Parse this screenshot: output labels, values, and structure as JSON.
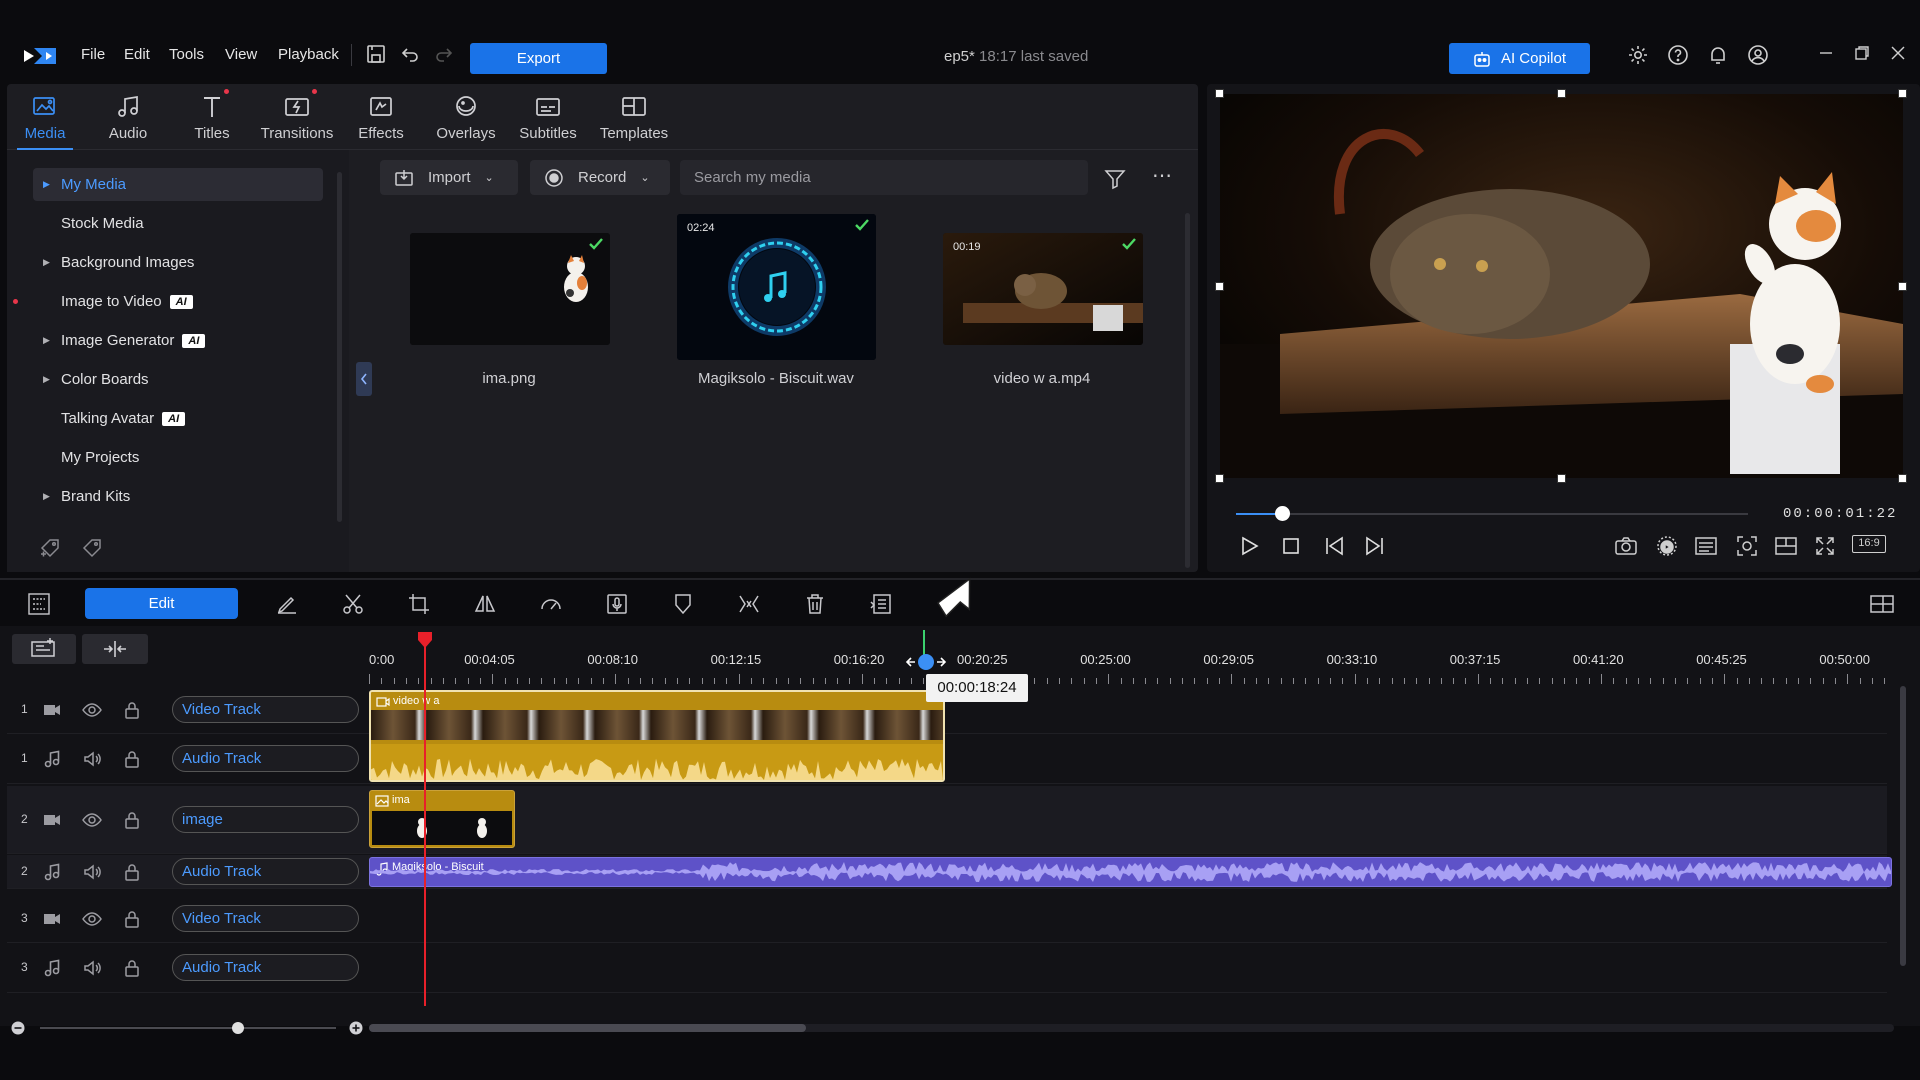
{
  "app": {
    "menu": [
      "File",
      "Edit",
      "Tools",
      "View",
      "Playback"
    ],
    "export_label": "Export",
    "project_name": "ep5*",
    "saved_status": "18:17 last saved",
    "copilot_label": "AI Copilot"
  },
  "tabs": [
    {
      "label": "Media",
      "icon": "media-icon",
      "active": true
    },
    {
      "label": "Audio",
      "icon": "music-note-icon"
    },
    {
      "label": "Titles",
      "icon": "titles-icon",
      "new_dot": true
    },
    {
      "label": "Transitions",
      "icon": "transitions-icon",
      "new_dot": true
    },
    {
      "label": "Effects",
      "icon": "effects-icon"
    },
    {
      "label": "Overlays",
      "icon": "overlays-icon"
    },
    {
      "label": "Subtitles",
      "icon": "subtitles-icon"
    },
    {
      "label": "Templates",
      "icon": "templates-icon"
    }
  ],
  "sidebar": {
    "items": [
      {
        "label": "My Media",
        "arrow": true,
        "selected": true
      },
      {
        "label": "Stock Media"
      },
      {
        "label": "Background Images",
        "arrow": true
      },
      {
        "label": "Image to Video",
        "ai": true,
        "red_dot": true
      },
      {
        "label": "Image Generator",
        "arrow": true,
        "ai": true
      },
      {
        "label": "Color Boards",
        "arrow": true
      },
      {
        "label": "Talking Avatar",
        "ai": true
      },
      {
        "label": "My Projects"
      },
      {
        "label": "Brand Kits",
        "arrow": true
      }
    ],
    "ai_badge": "AI"
  },
  "media_toolbar": {
    "import_label": "Import",
    "record_label": "Record",
    "search_placeholder": "Search my media"
  },
  "media_items": [
    {
      "name": "ima.png",
      "duration": "",
      "type": "image"
    },
    {
      "name": "Magiksolo - Biscuit.wav",
      "duration": "02:24",
      "type": "audio"
    },
    {
      "name": "video w a.mp4",
      "duration": "00:19",
      "type": "video"
    }
  ],
  "preview": {
    "timecode": "00:00:01:22",
    "aspect": "16:9",
    "progress": 0.09
  },
  "timeline": {
    "edit_label": "Edit",
    "ruler": [
      "0:00",
      "00:04:05",
      "00:08:10",
      "00:12:15",
      "00:16:20",
      "00:20:25",
      "00:25:00",
      "00:29:05",
      "00:33:10",
      "00:37:15",
      "00:41:20",
      "00:45:25",
      "00:50:00"
    ],
    "tooltip": "00:00:18:24",
    "tracks": [
      {
        "num": "1",
        "kind": "video",
        "name": "Video Track"
      },
      {
        "num": "1",
        "kind": "audio",
        "name": "Audio Track"
      },
      {
        "num": "2",
        "kind": "video",
        "name": "image"
      },
      {
        "num": "2",
        "kind": "audio",
        "name": "Audio Track"
      },
      {
        "num": "3",
        "kind": "video",
        "name": "Video Track"
      },
      {
        "num": "3",
        "kind": "audio",
        "name": "Audio Track"
      }
    ],
    "clips": {
      "video": "video w a",
      "image": "ima",
      "audio": "Magiksolo - Biscuit"
    }
  },
  "colors": {
    "accent": "#1a73e8",
    "clip_gold": "#c89a14",
    "audio_purple": "#6b5fd6",
    "playhead": "#e8202a"
  }
}
